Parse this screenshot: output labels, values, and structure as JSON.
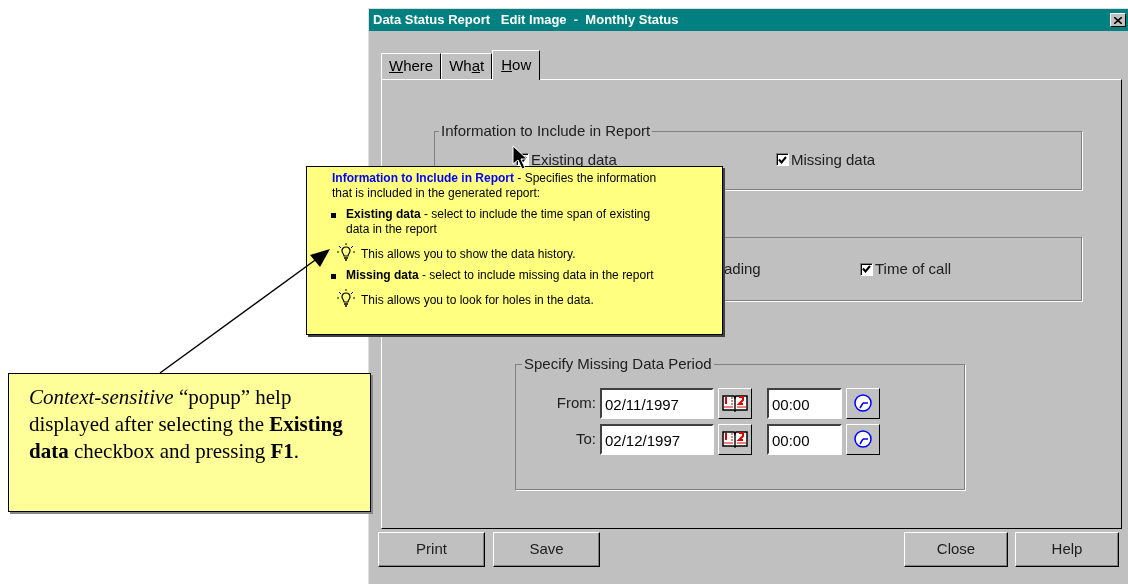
{
  "window": {
    "title": "Data Status Report   Edit Image  -  Monthly Status"
  },
  "tabs": [
    {
      "key": "W",
      "post": "here",
      "selected": false
    },
    {
      "pre": "Wh",
      "key": "a",
      "post": "t",
      "selected": false
    },
    {
      "key": "H",
      "post": "ow",
      "selected": true
    }
  ],
  "include_group": {
    "title": "Information to Include in Report",
    "options": [
      {
        "label": "Existing data",
        "checked": true
      },
      {
        "label": "Missing data",
        "checked": true
      }
    ]
  },
  "second_group": {
    "options": [
      {
        "kind": "text",
        "label": "ading"
      },
      {
        "kind": "checkbox",
        "label": "Time of call",
        "checked": true
      }
    ]
  },
  "period_group": {
    "title": "Specify Missing Data Period",
    "rows": [
      {
        "label": "From:",
        "date": "02/11/1997",
        "time": "00:00"
      },
      {
        "label": "To:",
        "date": "02/12/1997",
        "time": "00:00"
      }
    ]
  },
  "buttons_left": [
    "Print",
    "Save"
  ],
  "buttons_right": [
    "Close",
    "Help"
  ],
  "popup": {
    "intro": "**Information to Include in Report** - Specifies the information that is included in the generated report:",
    "items": [
      {
        "text": "**Existing data** - select to include the time span of existing data in the report",
        "tip": "This allows you to show the data history."
      },
      {
        "text": "**Missing data** - select to include missing data in the report",
        "tip": "This allows you to look for holes in the data."
      }
    ]
  },
  "callout": {
    "text": "*Context-sensitive* “popup” help displayed after selecting the **Existing data** checkbox and pressing **F1**."
  }
}
